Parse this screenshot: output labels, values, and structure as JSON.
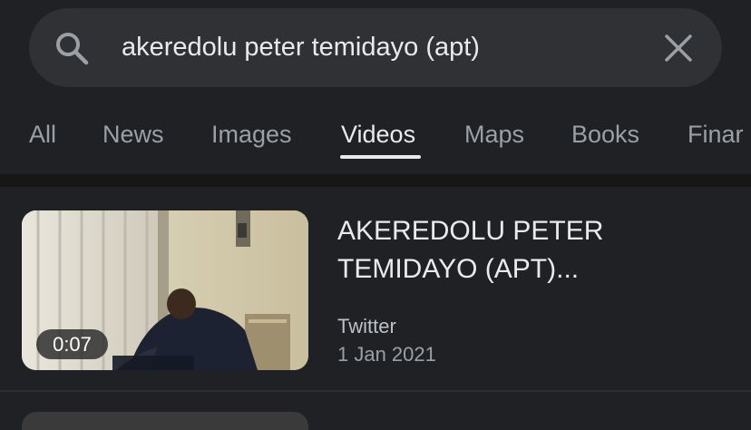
{
  "search": {
    "query": "akeredolu peter temidayo (apt)"
  },
  "tabs": [
    {
      "label": "All"
    },
    {
      "label": "News"
    },
    {
      "label": "Images"
    },
    {
      "label": "Videos",
      "active": true
    },
    {
      "label": "Maps"
    },
    {
      "label": "Books"
    },
    {
      "label": "Finar"
    }
  ],
  "result": {
    "title": "AKEREDOLU PETER TEMIDAYO (APT)...",
    "source": "Twitter",
    "date": "1 Jan 2021",
    "duration": "0:07"
  },
  "colors": {
    "background": "#202124",
    "search_box": "#303134",
    "text_primary": "#e8eaed",
    "text_secondary": "#9aa0a6"
  }
}
